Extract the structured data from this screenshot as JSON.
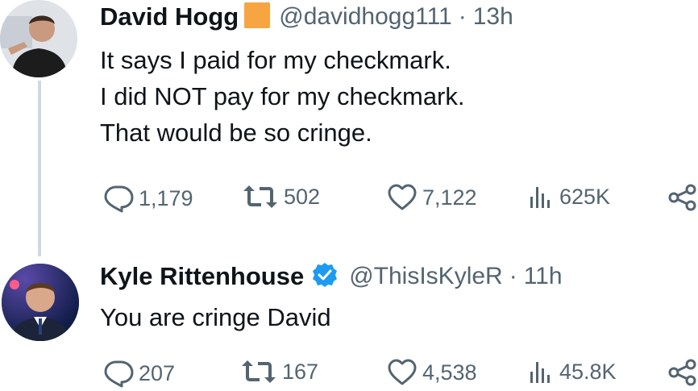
{
  "tweets": [
    {
      "display_name": "David Hogg",
      "handle": "@davidhogg111",
      "separator": "·",
      "time": "13h",
      "badge": "orange-square-icon",
      "lines": [
        "It says I paid for my checkmark.",
        "I did NOT pay for my checkmark.",
        "That would be so cringe."
      ],
      "replies": "1,179",
      "retweets": "502",
      "likes": "7,122",
      "views": "625K"
    },
    {
      "display_name": "Kyle Rittenhouse",
      "handle": "@ThisIsKyleR",
      "separator": "·",
      "time": "11h",
      "badge": "verified-check-icon",
      "lines": [
        "You are cringe David"
      ],
      "replies": "207",
      "retweets": "167",
      "likes": "4,538",
      "views": "45.8K"
    }
  ],
  "colors": {
    "verified_blue": "#1d9bf0",
    "badge_orange": "#f7a541",
    "muted": "#536471"
  }
}
